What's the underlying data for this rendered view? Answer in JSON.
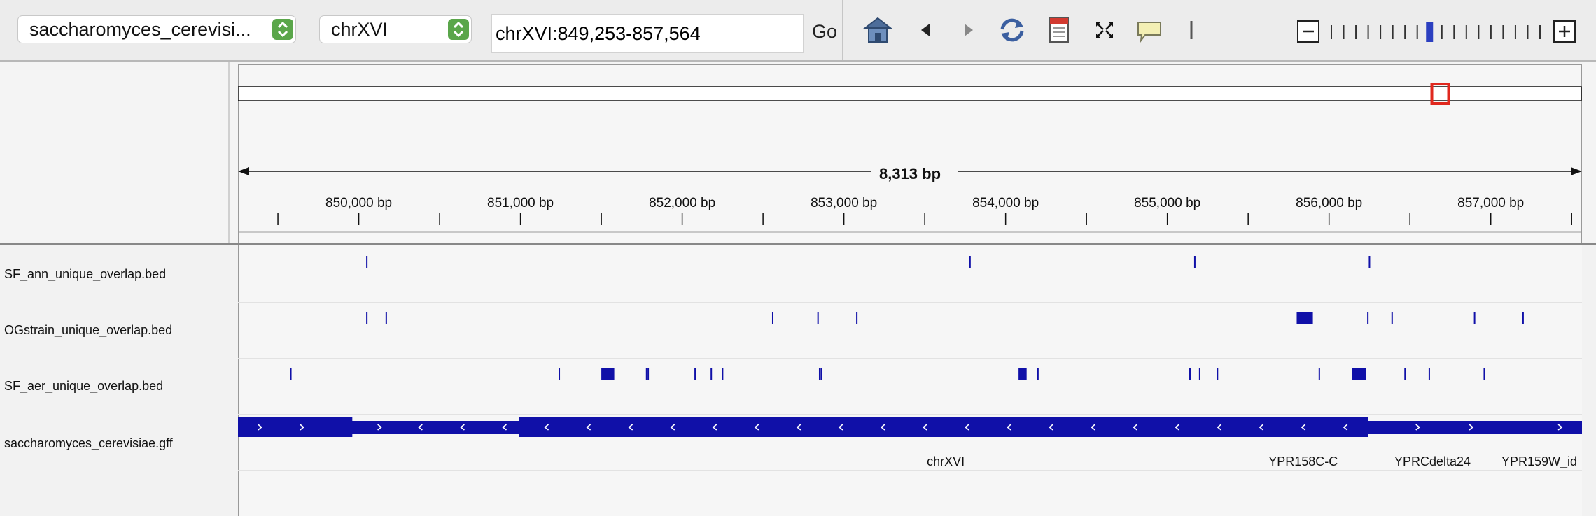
{
  "toolbar": {
    "genome": "saccharomyces_cerevisi...",
    "chromosome": "chrXVI",
    "locus": "chrXVI:849,253-857,564",
    "go_label": "Go",
    "icons": [
      "home-icon",
      "back-arrow-icon",
      "forward-arrow-icon",
      "refresh-icon",
      "region-of-interest-icon",
      "resize-to-window-icon",
      "popup-text-icon",
      "divider-line-icon",
      "zoom-out-icon",
      "zoom-in-icon"
    ],
    "zoom_level_index": 8,
    "zoom_levels": 18
  },
  "ruler": {
    "span_label": "8,313 bp",
    "ticks": [
      "850,000 bp",
      "851,000 bp",
      "852,000 bp",
      "853,000 bp",
      "854,000 bp",
      "855,000 bp",
      "856,000 bp",
      "857,000 bp"
    ],
    "view_start_bp": 849253,
    "view_end_bp": 857564,
    "chromosome_view_fraction": 0.895
  },
  "tracks": [
    {
      "name": "SF_ann_unique_overlap.bed"
    },
    {
      "name": "OGstrain_unique_overlap.bed"
    },
    {
      "name": "SF_aer_unique_overlap.bed"
    },
    {
      "name": "saccharomyces_cerevisiae.gff"
    }
  ],
  "features": {
    "sf_ann": [
      850050,
      853780,
      855170,
      856250
    ],
    "ogstrain": [
      850050,
      850170,
      852560,
      852840,
      853080,
      [
        855800,
        855900
      ],
      856240,
      856390,
      856900,
      857200
    ],
    "sf_aer": [
      849580,
      851240,
      [
        851500,
        851580
      ],
      851780,
      851790,
      852080,
      852180,
      852250,
      852850,
      852860,
      [
        854080,
        854130
      ],
      854200,
      855140,
      855200,
      855310,
      855940,
      [
        856140,
        856230
      ],
      856470,
      856620,
      856960
    ],
    "gff_labels": [
      {
        "text": "chrXVI",
        "bp": 853630
      },
      {
        "text": "YPR158C-C",
        "bp": 855840
      },
      {
        "text": "YPRCdelta24",
        "bp": 856640
      },
      {
        "text": "YPR159W_id",
        "bp": 857300
      }
    ]
  },
  "colors": {
    "feature": "#1010a8",
    "locator": "#e0281e",
    "combo_arrow": "#5aa64a"
  }
}
